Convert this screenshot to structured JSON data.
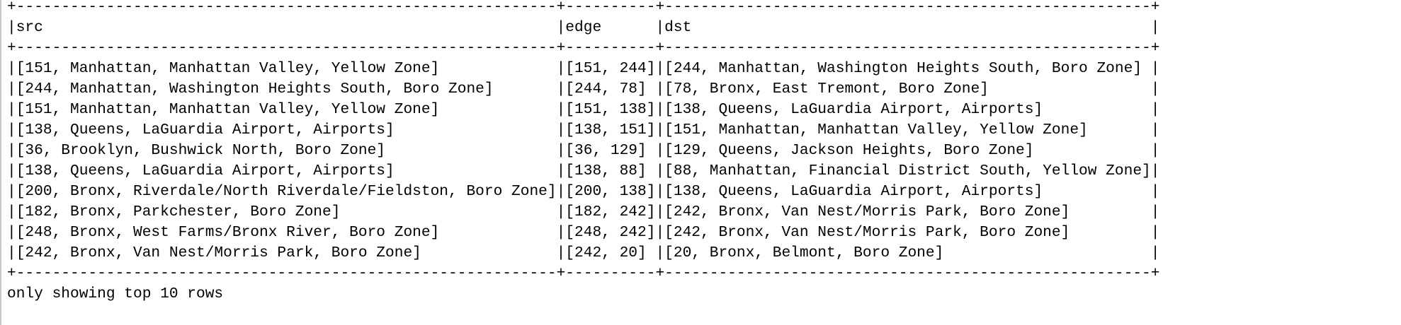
{
  "table": {
    "columns": [
      "src",
      "edge",
      "dst"
    ],
    "rows": [
      [
        "[151, Manhattan, Manhattan Valley, Yellow Zone]",
        "[151, 244]",
        "[244, Manhattan, Washington Heights South, Boro Zone]"
      ],
      [
        "[244, Manhattan, Washington Heights South, Boro Zone]",
        "[244, 78]",
        "[78, Bronx, East Tremont, Boro Zone]"
      ],
      [
        "[151, Manhattan, Manhattan Valley, Yellow Zone]",
        "[151, 138]",
        "[138, Queens, LaGuardia Airport, Airports]"
      ],
      [
        "[138, Queens, LaGuardia Airport, Airports]",
        "[138, 151]",
        "[151, Manhattan, Manhattan Valley, Yellow Zone]"
      ],
      [
        "[36, Brooklyn, Bushwick North, Boro Zone]",
        "[36, 129]",
        "[129, Queens, Jackson Heights, Boro Zone]"
      ],
      [
        "[138, Queens, LaGuardia Airport, Airports]",
        "[138, 88]",
        "[88, Manhattan, Financial District South, Yellow Zone]"
      ],
      [
        "[200, Bronx, Riverdale/North Riverdale/Fieldston, Boro Zone]",
        "[200, 138]",
        "[138, Queens, LaGuardia Airport, Airports]"
      ],
      [
        "[182, Bronx, Parkchester, Boro Zone]",
        "[182, 242]",
        "[242, Bronx, Van Nest/Morris Park, Boro Zone]"
      ],
      [
        "[248, Bronx, West Farms/Bronx River, Boro Zone]",
        "[248, 242]",
        "[242, Bronx, Van Nest/Morris Park, Boro Zone]"
      ],
      [
        "[242, Bronx, Van Nest/Morris Park, Boro Zone]",
        "[242, 20]",
        "[20, Bronx, Belmont, Boro Zone]"
      ]
    ]
  },
  "footer": {
    "note": "only showing top 10 rows"
  },
  "colors": {
    "text": "#000000",
    "background": "#ffffff",
    "gutter": "#c8c8c8"
  }
}
